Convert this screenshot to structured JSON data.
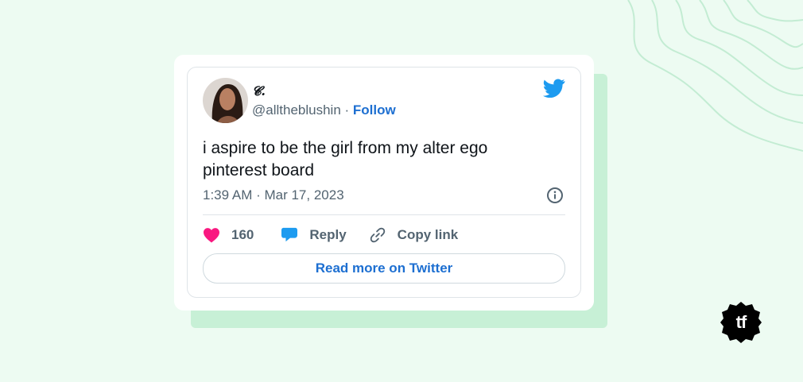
{
  "tweet": {
    "display_name": "𝓒.",
    "handle": "@alltheblushin",
    "separator": " · ",
    "follow_label": "Follow",
    "text": "i aspire to be the girl from my alter ego pinterest board",
    "timestamp": "1:39 AM · Mar 17, 2023",
    "likes": "160",
    "reply_label": "Reply",
    "copy_link_label": "Copy link",
    "read_more_label": "Read more on Twitter"
  },
  "brand_logo": {
    "text": "tf"
  },
  "colors": {
    "background": "#edfbf2",
    "shadow": "#c7f0d6",
    "twitter_blue": "#1d9bf0",
    "link_blue": "#1d6fd1",
    "heart": "#f91880"
  },
  "icons": [
    "avatar",
    "twitter-bird-icon",
    "info-icon",
    "heart-icon",
    "reply-bubble-icon",
    "link-icon"
  ]
}
